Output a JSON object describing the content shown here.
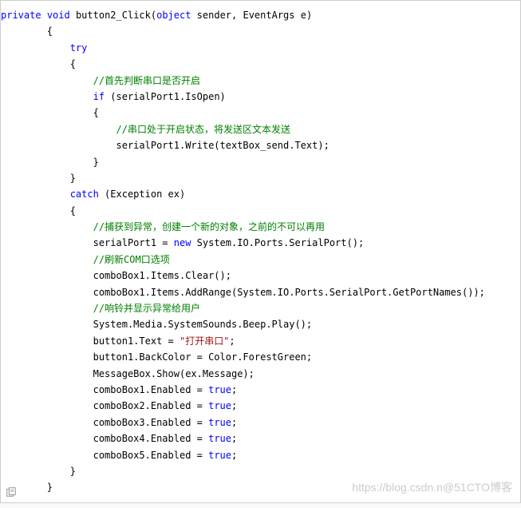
{
  "code": {
    "t0": "private",
    "t1": " ",
    "t2": "void",
    "t3": " button2_Click(",
    "t4": "object",
    "t5": " sender, EventArgs e)",
    "t6": "        {",
    "t7": "            ",
    "t8": "try",
    "t9": "            {",
    "t10": "                ",
    "t11": "//首先判断串口是否开启",
    "t12": "                ",
    "t13": "if",
    "t14": " (serialPort1.IsOpen)",
    "t15": "                {",
    "t16": "                    ",
    "t17": "//串口处于开启状态，将发送区文本发送",
    "t18": "                    serialPort1.Write(textBox_send.Text);",
    "t19": "                }",
    "t20": "            }",
    "t21": "            ",
    "t22": "catch",
    "t23": " (Exception ex)",
    "t24": "            {",
    "t25": "                ",
    "t26": "//捕获到异常，创建一个新的对象，之前的不可以再用",
    "t27": "                serialPort1 = ",
    "t28": "new",
    "t29": " System.IO.Ports.SerialPort();",
    "t30": "                ",
    "t31": "//刷新COM口选项",
    "t32": "                comboBox1.Items.Clear();",
    "t33": "                comboBox1.Items.AddRange(System.IO.Ports.SerialPort.GetPortNames());",
    "t34": "                ",
    "t35": "//响铃并显示异常给用户",
    "t36": "                System.Media.SystemSounds.Beep.Play();",
    "t37": "                button1.Text = ",
    "t38": "\"打开串口\"",
    "t39": ";",
    "t40": "                button1.BackColor = Color.ForestGreen;",
    "t41": "                MessageBox.Show(ex.Message);",
    "t42": "                comboBox1.Enabled = ",
    "t43": "true",
    "t44": ";",
    "t45": "                comboBox2.Enabled = ",
    "t46": "true",
    "t47": ";",
    "t48": "                comboBox3.Enabled = ",
    "t49": "true",
    "t50": ";",
    "t51": "                comboBox4.Enabled = ",
    "t52": "true",
    "t53": ";",
    "t54": "                comboBox5.Enabled = ",
    "t55": "true",
    "t56": ";",
    "t57": "            }",
    "t58": "        }"
  },
  "watermark": "https://blog.csdn.n@51CTO博客"
}
